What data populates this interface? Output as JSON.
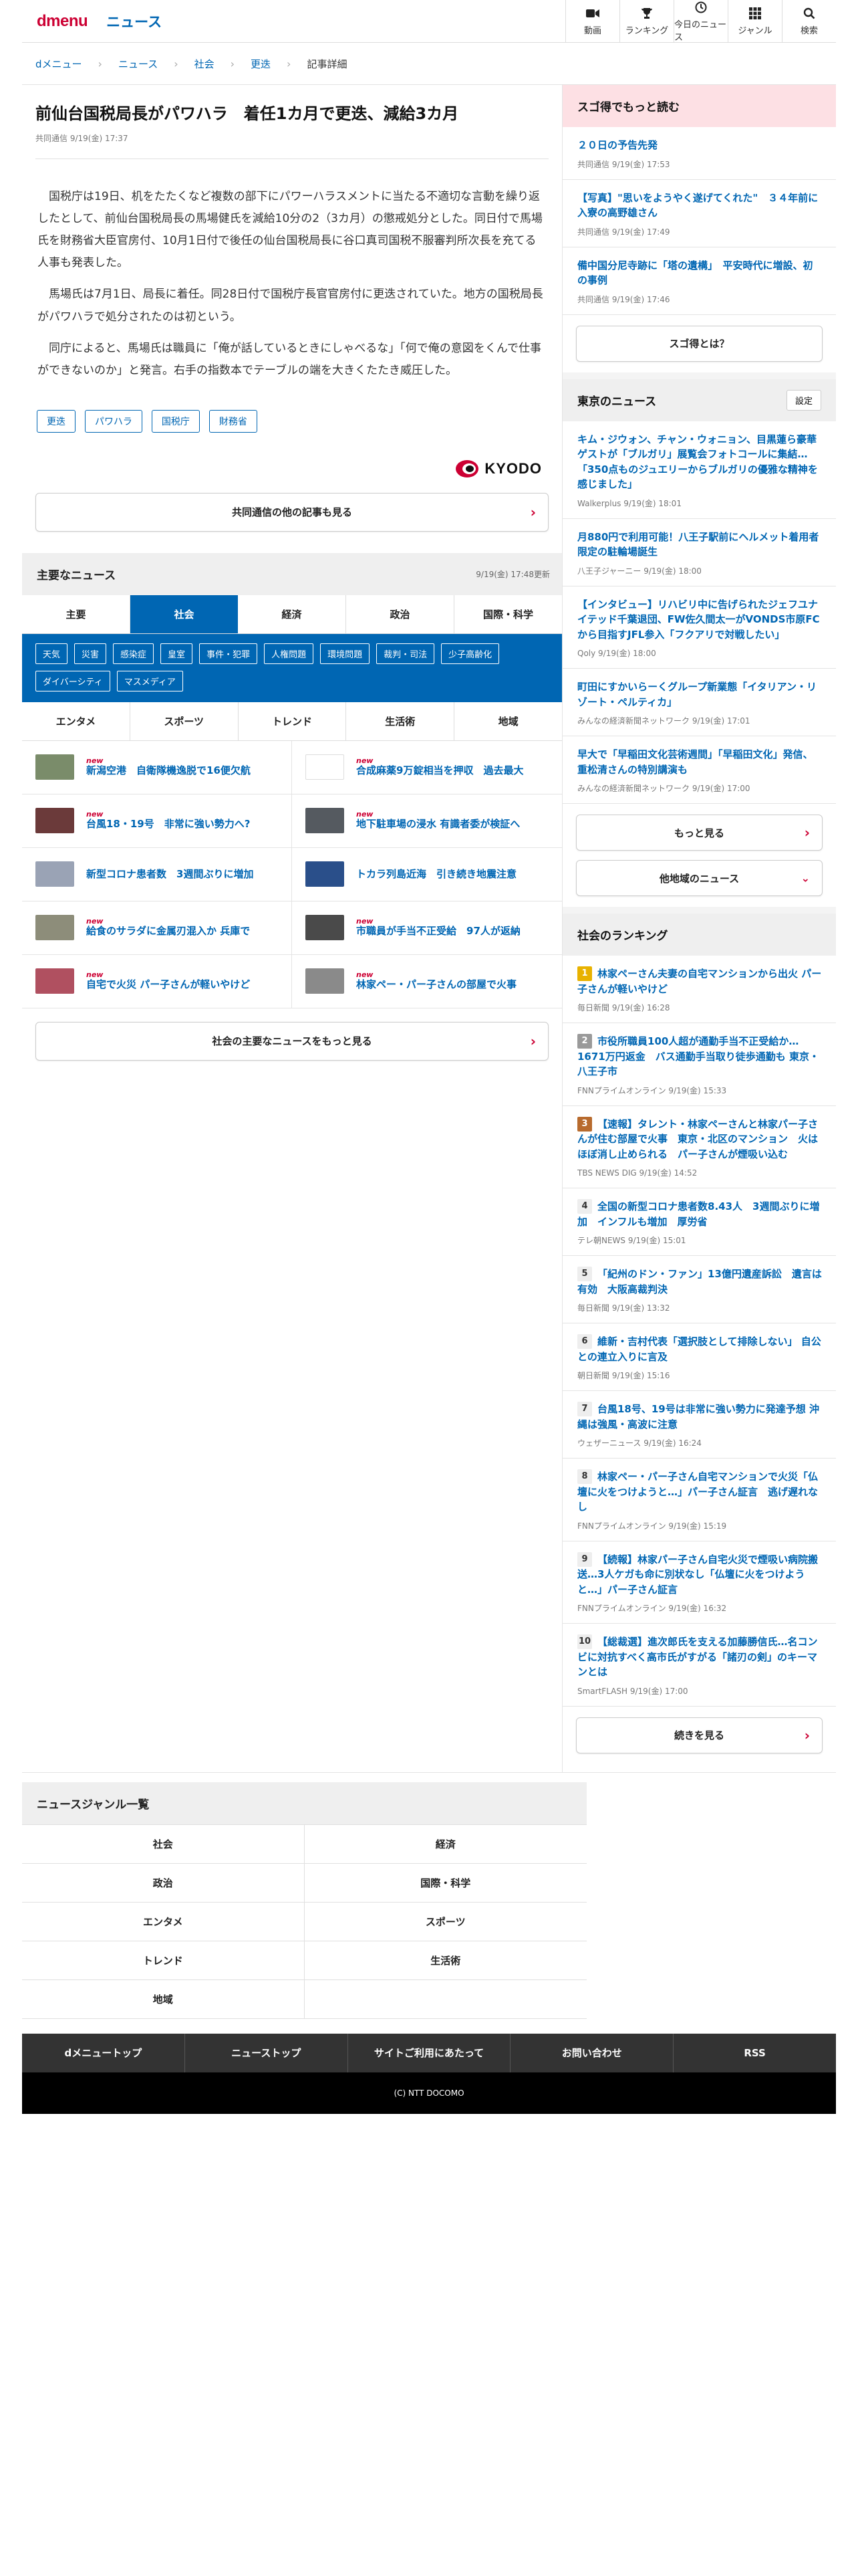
{
  "header": {
    "logo_d": "dmenu",
    "logo_news": "ニュース",
    "nav": [
      {
        "label": "動画",
        "icon": "video-icon"
      },
      {
        "label": "ランキング",
        "icon": "trophy-icon"
      },
      {
        "label": "今日のニュース",
        "icon": "clock-icon"
      },
      {
        "label": "ジャンル",
        "icon": "grid-icon"
      },
      {
        "label": "検索",
        "icon": "search-icon"
      }
    ]
  },
  "breadcrumb": [
    "dメニュー",
    "ニュース",
    "社会",
    "更迭",
    "記事詳細"
  ],
  "article": {
    "title": "前仙台国税局長がパワハラ　着任1カ月で更迭、減給3カ月",
    "meta": "共同通信 9/19(金) 17:37",
    "paragraphs": [
      "国税庁は19日、机をたたくなど複数の部下にパワーハラスメントに当たる不適切な言動を繰り返したとして、前仙台国税局長の馬場健氏を減給10分の2（3カ月）の懲戒処分とした。同日付で馬場氏を財務省大臣官房付、10月1日付で後任の仙台国税局長に谷口真司国税不服審判所次長を充てる人事も発表した。",
      "馬場氏は7月1日、局長に着任。同28日付で国税庁長官官房付に更迭されていた。地方の国税局長がパワハラで処分されたのは初という。",
      "同庁によると、馬場氏は職員に「俺が話しているときにしゃべるな」「何で俺の意図をくんで仕事ができないのか」と発言。右手の指数本でテーブルの端を大きくたたき威圧した。"
    ],
    "tags": [
      "更迭",
      "パワハラ",
      "国税庁",
      "財務省"
    ],
    "source_logo": "KYODO",
    "more_button": "共同通信の他の記事も見る"
  },
  "main_news": {
    "title": "主要なニュース",
    "updated": "9/19(金) 17:48更新",
    "tabs": [
      "主要",
      "社会",
      "経済",
      "政治",
      "国際・科学"
    ],
    "active_tab": 1,
    "subtags": [
      "天気",
      "災害",
      "感染症",
      "皇室",
      "事件・犯罪",
      "人権問題",
      "環境問題",
      "裁判・司法",
      "少子高齢化",
      "ダイバーシティ",
      "マスメディア"
    ],
    "tabs2": [
      "エンタメ",
      "スポーツ",
      "トレンド",
      "生活術",
      "地域"
    ],
    "new_label": "new",
    "items": [
      {
        "title": "新潟空港　自衛隊機逸脱で16便欠航",
        "is_new": true,
        "thumb": "#7a8c6a"
      },
      {
        "title": "合成麻薬9万錠相当を押収　過去最大",
        "is_new": true,
        "thumb": ""
      },
      {
        "title": "台風18・19号　非常に強い勢力へ?",
        "is_new": true,
        "thumb": "#6b3a3a"
      },
      {
        "title": "地下駐車場の浸水 有識者委が検証へ",
        "is_new": true,
        "thumb": "#555a60"
      },
      {
        "title": "新型コロナ患者数　3週間ぶりに増加",
        "is_new": false,
        "thumb": "#9aa3b5"
      },
      {
        "title": "トカラ列島近海　引き続き地震注意",
        "is_new": false,
        "thumb": "#2a4f8a"
      },
      {
        "title": "給食のサラダに金属刃混入か 兵庫で",
        "is_new": true,
        "thumb": "#8d8d7a"
      },
      {
        "title": "市職員が手当不正受給　97人が返納",
        "is_new": true,
        "thumb": "#4a4a4a"
      },
      {
        "title": "自宅で火災 パー子さんが軽いやけど",
        "is_new": true,
        "thumb": "#b05060"
      },
      {
        "title": "林家ペー・パー子さんの部屋で火事",
        "is_new": true,
        "thumb": "#8a8a8a"
      }
    ],
    "more_button": "社会の主要なニュースをもっと見る"
  },
  "side": {
    "sugotoku": {
      "title": "スゴ得でもっと読む",
      "items": [
        {
          "title": "２０日の予告先発",
          "src": "共同通信 9/19(金) 17:53"
        },
        {
          "title": "【写真】\"思いをようやく遂げてくれた\"　３４年前に入寮の高野雄さん",
          "src": "共同通信 9/19(金) 17:49"
        },
        {
          "title": "備中国分尼寺跡に「塔の遺構」　平安時代に増設、初の事例",
          "src": "共同通信 9/19(金) 17:46"
        }
      ],
      "button": "スゴ得とは？"
    },
    "tokyo": {
      "title": "東京のニュース",
      "setting": "設定",
      "items": [
        {
          "title": "キム・ジウォン、チャン・ウォニョン、目黒蓮ら豪華ゲストが「ブルガリ」展覧会フォトコールに集結…「350点ものジュエリーからブルガリの優雅な精神を感じました」",
          "src": "Walkerplus 9/19(金) 18:01"
        },
        {
          "title": "月880円で利用可能！八王子駅前にヘルメット着用者限定の駐輪場誕生",
          "src": "八王子ジャーニー 9/19(金) 18:00"
        },
        {
          "title": "【インタビュー】リハビリ中に告げられたジェフユナイテッド千葉退団、FW佐久間太一がVONDS市原FCから目指すJFL参入「フクアリで対戦したい」",
          "src": "Qoly 9/19(金) 18:00"
        },
        {
          "title": "町田にすかいらーくグループ新業態「イタリアン・リゾート・ペルティカ」",
          "src": "みんなの経済新聞ネットワーク 9/19(金) 17:01"
        },
        {
          "title": "早大で「早稲田文化芸術週間」「早稲田文化」発信、重松清さんの特別講演も",
          "src": "みんなの経済新聞ネットワーク 9/19(金) 17:00"
        }
      ],
      "more": "もっと見る",
      "other": "他地域のニュース"
    },
    "ranking": {
      "title": "社会のランキング",
      "items": [
        {
          "rank": "1",
          "title": "林家ペーさん夫妻の自宅マンションから出火 パー子さんが軽いやけど",
          "src": "毎日新聞 9/19(金) 16:28"
        },
        {
          "rank": "2",
          "title": "市役所職員100人超が通勤手当不正受給か…1671万円返金　バス通勤手当取り徒歩通勤も 東京・八王子市",
          "src": "FNNプライムオンライン 9/19(金) 15:33"
        },
        {
          "rank": "3",
          "title": "【速報】タレント・林家ペーさんと林家パー子さんが住む部屋で火事　東京・北区のマンション　火はほぼ消し止められる　パー子さんが煙吸い込む",
          "src": "TBS NEWS DIG 9/19(金) 14:52"
        },
        {
          "rank": "4",
          "title": "全国の新型コロナ患者数8.43人　3週間ぶりに増加　インフルも増加　厚労省",
          "src": "テレ朝NEWS 9/19(金) 15:01"
        },
        {
          "rank": "5",
          "title": "「紀州のドン・ファン」13億円遺産訴訟　遺言は有効　大阪高裁判決",
          "src": "毎日新聞 9/19(金) 13:32"
        },
        {
          "rank": "6",
          "title": "維新・吉村代表「選択肢として排除しない」 自公との連立入りに言及",
          "src": "朝日新聞 9/19(金) 15:16"
        },
        {
          "rank": "7",
          "title": "台風18号、19号は非常に強い勢力に発達予想 沖縄は強風・高波に注意",
          "src": "ウェザーニュース 9/19(金) 16:24"
        },
        {
          "rank": "8",
          "title": "林家ペー・パー子さん自宅マンションで火災「仏壇に火をつけようと…」パー子さん証言　逃げ遅れなし",
          "src": "FNNプライムオンライン 9/19(金) 15:19"
        },
        {
          "rank": "9",
          "title": "【続報】林家パー子さん自宅火災で煙吸い病院搬送…3人ケガも命に別状なし「仏壇に火をつけようと…」パー子さん証言",
          "src": "FNNプライムオンライン 9/19(金) 16:32"
        },
        {
          "rank": "10",
          "title": "【総裁選】進次郎氏を支える加藤勝信氏…名コンビに対抗すべく高市氏がすがる「諸刃の剣」のキーマンとは",
          "src": "SmartFLASH 9/19(金) 17:00"
        }
      ],
      "button": "続きを見る"
    }
  },
  "genre": {
    "title": "ニュースジャンル一覧",
    "items": [
      "社会",
      "経済",
      "政治",
      "国際・科学",
      "エンタメ",
      "スポーツ",
      "トレンド",
      "生活術",
      "地域",
      ""
    ]
  },
  "footer": {
    "links": [
      "dメニュートップ",
      "ニューストップ",
      "サイトご利用にあたって",
      "お問い合わせ",
      "RSS"
    ],
    "copyright": "(C) NTT DOCOMO"
  }
}
